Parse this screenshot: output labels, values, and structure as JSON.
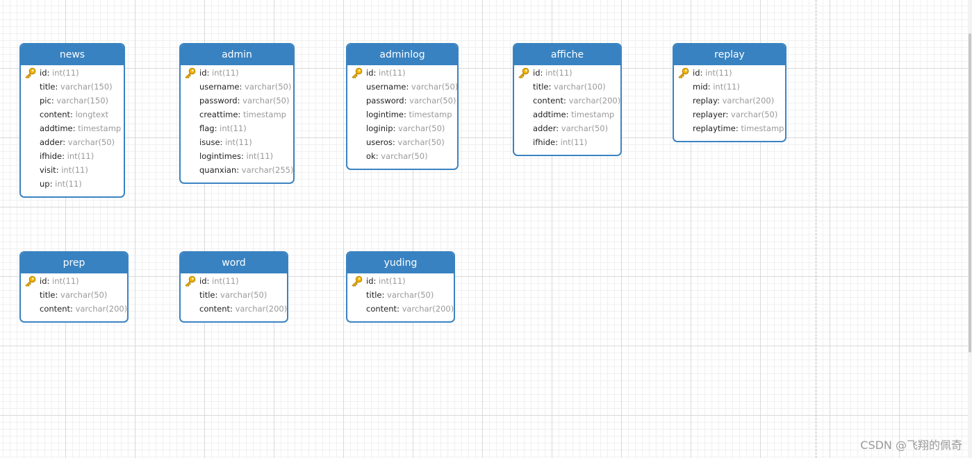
{
  "tables": [
    {
      "name": "news",
      "fields": [
        {
          "name": "id",
          "type": "int(11)",
          "key": true
        },
        {
          "name": "title",
          "type": "varchar(150)",
          "key": false
        },
        {
          "name": "pic",
          "type": "varchar(150)",
          "key": false
        },
        {
          "name": "content",
          "type": "longtext",
          "key": false
        },
        {
          "name": "addtime",
          "type": "timestamp",
          "key": false
        },
        {
          "name": "adder",
          "type": "varchar(50)",
          "key": false
        },
        {
          "name": "ifhide",
          "type": "int(11)",
          "key": false
        },
        {
          "name": "visit",
          "type": "int(11)",
          "key": false
        },
        {
          "name": "up",
          "type": "int(11)",
          "key": false
        }
      ]
    },
    {
      "name": "admin",
      "fields": [
        {
          "name": "id",
          "type": "int(11)",
          "key": true
        },
        {
          "name": "username",
          "type": "varchar(50)",
          "key": false
        },
        {
          "name": "password",
          "type": "varchar(50)",
          "key": false
        },
        {
          "name": "creattime",
          "type": "timestamp",
          "key": false
        },
        {
          "name": "flag",
          "type": "int(11)",
          "key": false
        },
        {
          "name": "isuse",
          "type": "int(11)",
          "key": false
        },
        {
          "name": "logintimes",
          "type": "int(11)",
          "key": false
        },
        {
          "name": "quanxian",
          "type": "varchar(255)",
          "key": false
        }
      ]
    },
    {
      "name": "adminlog",
      "fields": [
        {
          "name": "id",
          "type": "int(11)",
          "key": true
        },
        {
          "name": "username",
          "type": "varchar(50)",
          "key": false
        },
        {
          "name": "password",
          "type": "varchar(50)",
          "key": false
        },
        {
          "name": "logintime",
          "type": "timestamp",
          "key": false
        },
        {
          "name": "loginip",
          "type": "varchar(50)",
          "key": false
        },
        {
          "name": "useros",
          "type": "varchar(50)",
          "key": false
        },
        {
          "name": "ok",
          "type": "varchar(50)",
          "key": false
        }
      ]
    },
    {
      "name": "affiche",
      "fields": [
        {
          "name": "id",
          "type": "int(11)",
          "key": true
        },
        {
          "name": "title",
          "type": "varchar(100)",
          "key": false
        },
        {
          "name": "content",
          "type": "varchar(200)",
          "key": false
        },
        {
          "name": "addtime",
          "type": "timestamp",
          "key": false
        },
        {
          "name": "adder",
          "type": "varchar(50)",
          "key": false
        },
        {
          "name": "ifhide",
          "type": "int(11)",
          "key": false
        }
      ]
    },
    {
      "name": "replay",
      "fields": [
        {
          "name": "id",
          "type": "int(11)",
          "key": true
        },
        {
          "name": "mid",
          "type": "int(11)",
          "key": false
        },
        {
          "name": "replay",
          "type": "varchar(200)",
          "key": false
        },
        {
          "name": "replayer",
          "type": "varchar(50)",
          "key": false
        },
        {
          "name": "replaytime",
          "type": "timestamp",
          "key": false
        }
      ]
    },
    {
      "name": "prep",
      "fields": [
        {
          "name": "id",
          "type": "int(11)",
          "key": true
        },
        {
          "name": "title",
          "type": "varchar(50)",
          "key": false
        },
        {
          "name": "content",
          "type": "varchar(200)",
          "key": false
        }
      ]
    },
    {
      "name": "word",
      "fields": [
        {
          "name": "id",
          "type": "int(11)",
          "key": true
        },
        {
          "name": "title",
          "type": "varchar(50)",
          "key": false
        },
        {
          "name": "content",
          "type": "varchar(200)",
          "key": false
        }
      ]
    },
    {
      "name": "yuding",
      "fields": [
        {
          "name": "id",
          "type": "int(11)",
          "key": true
        },
        {
          "name": "title",
          "type": "varchar(50)",
          "key": false
        },
        {
          "name": "content",
          "type": "varchar(200)",
          "key": false
        }
      ]
    }
  ],
  "watermark": "CSDN @飞翔的佩奇",
  "icons": {
    "primary_key": "key-icon"
  },
  "colors": {
    "header": "#3882c1",
    "border": "#3a83c3",
    "type_text": "#999999",
    "key": "#f2b400"
  }
}
